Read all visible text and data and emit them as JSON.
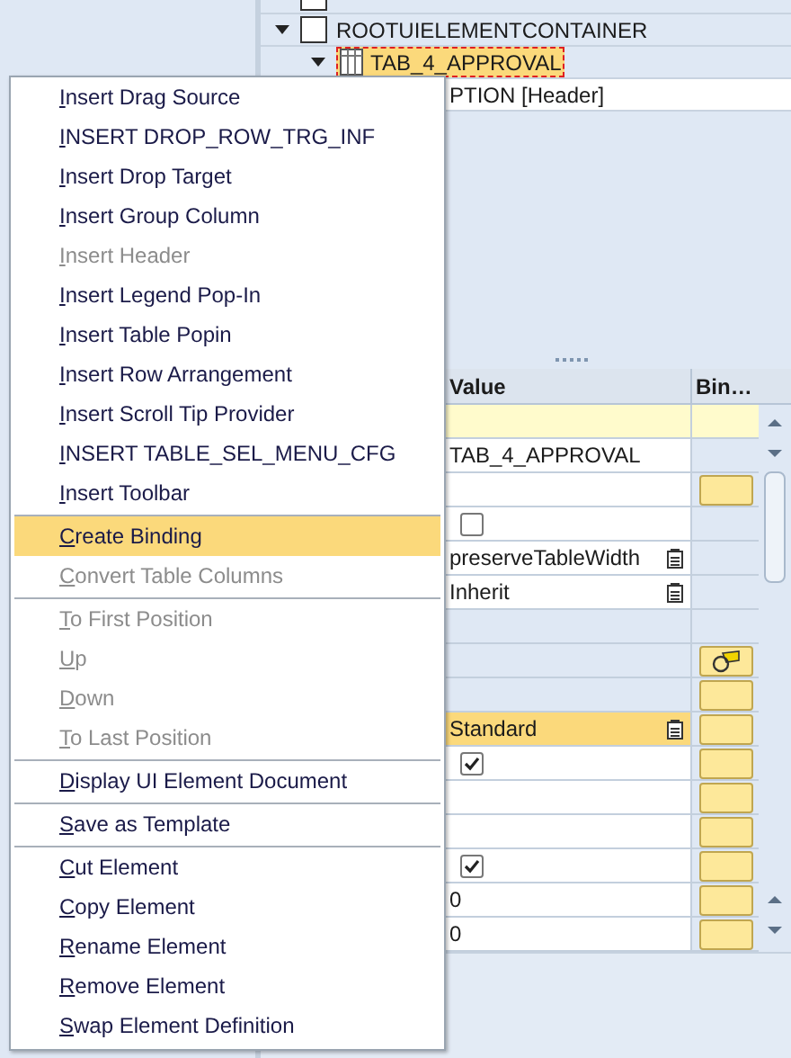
{
  "tree": [
    {
      "kind": "element",
      "selected": false
    },
    {
      "label": "ROOTUIELEMENTCONTAINER",
      "kind": "element",
      "expanded": true,
      "selected": false,
      "children": [
        {
          "label": "TAB_4_APPROVAL",
          "kind": "table",
          "expanded": true,
          "selected": true,
          "children": [
            {
              "label": "PTION  [Header]",
              "selected": false
            }
          ]
        }
      ]
    }
  ],
  "properties": {
    "columns": [
      "Value",
      "Bin…"
    ],
    "rows": [
      {
        "kind": "group",
        "binding_button": false,
        "bound": false,
        "selected": false
      },
      {
        "kind": "text",
        "value": "TAB_4_APPROVAL",
        "editable": true,
        "binding_button": false,
        "bound": false,
        "selected": false
      },
      {
        "kind": "empty",
        "editable": true,
        "binding_button": true,
        "bound": false,
        "selected": false
      },
      {
        "kind": "checkbox",
        "checked": false,
        "editable": true,
        "binding_button": false,
        "bound": false,
        "selected": false
      },
      {
        "kind": "dropdown",
        "value": "preserveTableWidth",
        "editable": true,
        "binding_button": false,
        "bound": false,
        "selected": false
      },
      {
        "kind": "dropdown",
        "value": "Inherit",
        "editable": true,
        "binding_button": false,
        "bound": false,
        "selected": false
      },
      {
        "kind": "empty",
        "editable": false,
        "binding_button": false,
        "bound": false,
        "selected": false
      },
      {
        "kind": "empty",
        "editable": false,
        "binding_button": true,
        "bound": true,
        "selected": false
      },
      {
        "kind": "empty",
        "editable": false,
        "binding_button": true,
        "bound": false,
        "selected": false
      },
      {
        "kind": "dropdown",
        "value": "Standard",
        "editable": true,
        "binding_button": true,
        "bound": false,
        "selected": true
      },
      {
        "kind": "checkbox",
        "checked": true,
        "editable": true,
        "binding_button": true,
        "bound": false,
        "selected": false
      },
      {
        "kind": "empty",
        "editable": true,
        "binding_button": true,
        "bound": false,
        "selected": false
      },
      {
        "kind": "empty",
        "editable": true,
        "binding_button": true,
        "bound": false,
        "selected": false
      },
      {
        "kind": "checkbox",
        "checked": true,
        "editable": true,
        "binding_button": true,
        "bound": false,
        "selected": false
      },
      {
        "kind": "text",
        "value": "0",
        "editable": true,
        "binding_button": true,
        "bound": false,
        "selected": false
      },
      {
        "kind": "text",
        "value": "0",
        "editable": true,
        "binding_button": true,
        "bound": false,
        "selected": false
      }
    ]
  },
  "context_menu": [
    {
      "kind": "item",
      "label": "Insert Drag Source",
      "disabled": false,
      "selected": false
    },
    {
      "kind": "item",
      "label": "INSERT DROP_ROW_TRG_INF",
      "disabled": false,
      "selected": false
    },
    {
      "kind": "item",
      "label": "Insert Drop Target",
      "disabled": false,
      "selected": false
    },
    {
      "kind": "item",
      "label": "Insert Group Column",
      "disabled": false,
      "selected": false
    },
    {
      "kind": "item",
      "label": "Insert Header",
      "disabled": true,
      "selected": false
    },
    {
      "kind": "item",
      "label": "Insert Legend Pop-In",
      "disabled": false,
      "selected": false
    },
    {
      "kind": "item",
      "label": "Insert Table Popin",
      "disabled": false,
      "selected": false
    },
    {
      "kind": "item",
      "label": "Insert Row Arrangement",
      "disabled": false,
      "selected": false
    },
    {
      "kind": "item",
      "label": "Insert Scroll Tip Provider",
      "disabled": false,
      "selected": false
    },
    {
      "kind": "item",
      "label": "INSERT TABLE_SEL_MENU_CFG",
      "disabled": false,
      "selected": false
    },
    {
      "kind": "item",
      "label": "Insert Toolbar",
      "disabled": false,
      "selected": false
    },
    {
      "kind": "separator"
    },
    {
      "kind": "item",
      "label": "Create Binding",
      "disabled": false,
      "selected": true
    },
    {
      "kind": "item",
      "label": "Convert Table Columns",
      "disabled": true,
      "selected": false
    },
    {
      "kind": "separator"
    },
    {
      "kind": "item",
      "label": "To First Position",
      "disabled": true,
      "selected": false
    },
    {
      "kind": "item",
      "label": "Up",
      "disabled": true,
      "selected": false
    },
    {
      "kind": "item",
      "label": "Down",
      "disabled": true,
      "selected": false
    },
    {
      "kind": "item",
      "label": "To Last Position",
      "disabled": true,
      "selected": false
    },
    {
      "kind": "separator"
    },
    {
      "kind": "item",
      "label": "Display UI Element Document",
      "disabled": false,
      "selected": false
    },
    {
      "kind": "separator"
    },
    {
      "kind": "item",
      "label": "Save as Template",
      "disabled": false,
      "selected": false
    },
    {
      "kind": "separator"
    },
    {
      "kind": "item",
      "label": "Cut Element",
      "disabled": false,
      "selected": false
    },
    {
      "kind": "item",
      "label": "Copy Element",
      "disabled": false,
      "selected": false
    },
    {
      "kind": "item",
      "label": "Rename Element",
      "disabled": false,
      "selected": false
    },
    {
      "kind": "item",
      "label": "Remove Element",
      "disabled": false,
      "selected": false
    },
    {
      "kind": "item",
      "label": "Swap Element Definition",
      "disabled": false,
      "selected": false
    }
  ]
}
